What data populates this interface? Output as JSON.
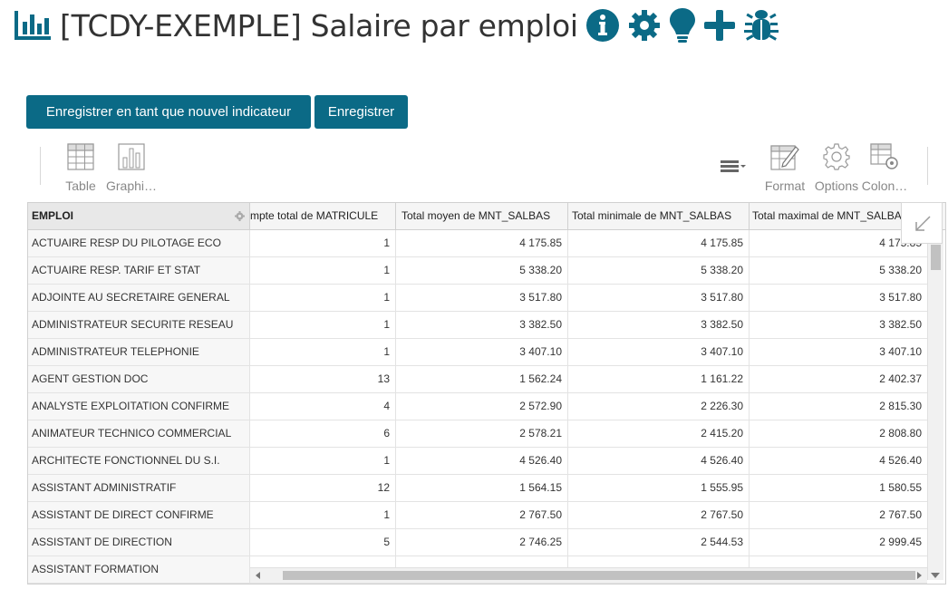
{
  "title": "[TCDY-EXEMPLE] Salaire par emploi",
  "colors": {
    "accent": "#0b6a86",
    "button_bg": "#0b6a86"
  },
  "buttons": {
    "save_new": "Enregistrer en tant que nouvel indicateur",
    "save": "Enregistrer"
  },
  "toolbar": {
    "table": "Table",
    "graph": "Graphi…",
    "format": "Format",
    "options": "Options",
    "columns": "Colon…"
  },
  "grid": {
    "headers": {
      "emploi": "EMPLOI",
      "count": "mpte total de MATRICULE",
      "avg": "Total moyen de MNT_SALBAS",
      "min": "Total minimale de MNT_SALBAS",
      "max": "Total maximal de MNT_SALBAS"
    },
    "rows": [
      {
        "emploi": "ACTUAIRE RESP DU PILOTAGE ECO",
        "count": "1",
        "avg": "4 175.85",
        "min": "4 175.85",
        "max": "4 175.85"
      },
      {
        "emploi": "ACTUAIRE RESP. TARIF ET STAT",
        "count": "1",
        "avg": "5 338.20",
        "min": "5 338.20",
        "max": "5 338.20"
      },
      {
        "emploi": "ADJOINTE AU SECRETAIRE GENERAL",
        "count": "1",
        "avg": "3 517.80",
        "min": "3 517.80",
        "max": "3 517.80"
      },
      {
        "emploi": "ADMINISTRATEUR SECURITE RESEAU",
        "count": "1",
        "avg": "3 382.50",
        "min": "3 382.50",
        "max": "3 382.50"
      },
      {
        "emploi": "ADMINISTRATEUR TELEPHONIE",
        "count": "1",
        "avg": "3 407.10",
        "min": "3 407.10",
        "max": "3 407.10"
      },
      {
        "emploi": "AGENT GESTION DOC",
        "count": "13",
        "avg": "1 562.24",
        "min": "1 161.22",
        "max": "2 402.37"
      },
      {
        "emploi": "ANALYSTE EXPLOITATION CONFIRME",
        "count": "4",
        "avg": "2 572.90",
        "min": "2 226.30",
        "max": "2 815.30"
      },
      {
        "emploi": "ANIMATEUR TECHNICO COMMERCIAL",
        "count": "6",
        "avg": "2 578.21",
        "min": "2 415.20",
        "max": "2 808.80"
      },
      {
        "emploi": "ARCHITECTE FONCTIONNEL DU S.I.",
        "count": "1",
        "avg": "4 526.40",
        "min": "4 526.40",
        "max": "4 526.40"
      },
      {
        "emploi": "ASSISTANT ADMINISTRATIF",
        "count": "12",
        "avg": "1 564.15",
        "min": "1 555.95",
        "max": "1 580.55"
      },
      {
        "emploi": "ASSISTANT DE DIRECT CONFIRME",
        "count": "1",
        "avg": "2 767.50",
        "min": "2 767.50",
        "max": "2 767.50"
      },
      {
        "emploi": "ASSISTANT DE DIRECTION",
        "count": "5",
        "avg": "2 746.25",
        "min": "2 544.53",
        "max": "2 999.45"
      },
      {
        "emploi": "ASSISTANT FORMATION",
        "count": "",
        "avg": "",
        "min": "",
        "max": ""
      }
    ]
  }
}
